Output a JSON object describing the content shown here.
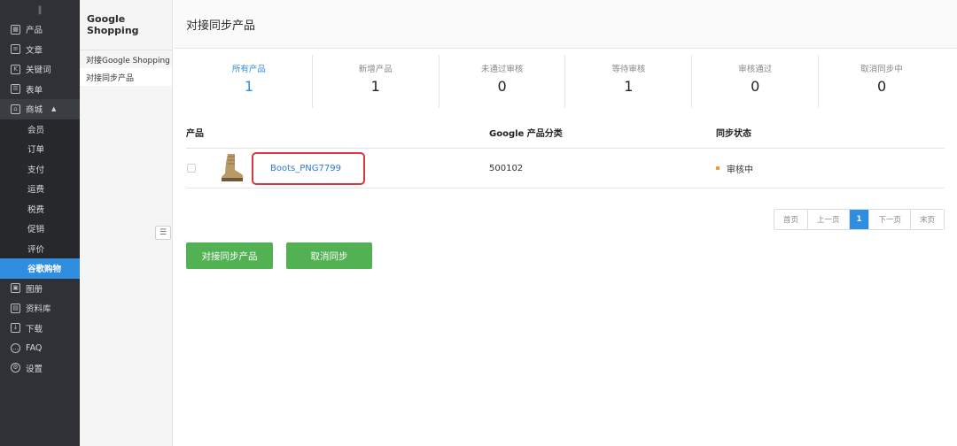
{
  "sidebar": {
    "top_icon": "‖",
    "items": [
      {
        "label": "产品",
        "icon": "grid-icon"
      },
      {
        "label": "文章",
        "icon": "document-icon"
      },
      {
        "label": "关键词",
        "icon": "keyword-icon"
      },
      {
        "label": "表单",
        "icon": "form-icon"
      },
      {
        "label": "商城",
        "icon": "shop-bag-icon"
      }
    ],
    "shop_sub": [
      {
        "label": "会员"
      },
      {
        "label": "订单"
      },
      {
        "label": "支付"
      },
      {
        "label": "运费"
      },
      {
        "label": "税费"
      },
      {
        "label": "促销"
      },
      {
        "label": "评价"
      },
      {
        "label": "谷歌购物"
      }
    ],
    "items_after": [
      {
        "label": "图册",
        "icon": "album-icon"
      },
      {
        "label": "资料库",
        "icon": "library-icon"
      },
      {
        "label": "下载",
        "icon": "download-icon"
      },
      {
        "label": "FAQ",
        "icon": "chat-icon"
      },
      {
        "label": "设置",
        "icon": "gear-icon"
      }
    ]
  },
  "panel2": {
    "title": "Google Shopping",
    "items": [
      {
        "label": "对接Google Shopping"
      },
      {
        "label": "对接同步产品"
      }
    ],
    "collapse_icon": "☰"
  },
  "main": {
    "header": "对接同步产品",
    "stats": [
      {
        "label": "所有产品",
        "value": "1"
      },
      {
        "label": "新增产品",
        "value": "1"
      },
      {
        "label": "未通过审核",
        "value": "0"
      },
      {
        "label": "等待审核",
        "value": "1"
      },
      {
        "label": "审核通过",
        "value": "0"
      },
      {
        "label": "取消同步中",
        "value": "0"
      }
    ],
    "table": {
      "headers": {
        "product": "产品",
        "category": "Google 产品分类",
        "status": "同步状态"
      },
      "rows": [
        {
          "product": "Boots_PNG7799",
          "category": "500102",
          "status": "审核中"
        }
      ]
    },
    "pager": {
      "first": "首页",
      "prev": "上一页",
      "current": "1",
      "next": "下一页",
      "last": "末页"
    },
    "buttons": {
      "sync": "对接同步产品",
      "cancel": "取消同步"
    }
  },
  "colors": {
    "sidebar_bg": "#2f3136",
    "accent": "#2f8ee0",
    "button_green": "#52b153",
    "highlight_red": "#d9373f",
    "status_dot": "#f0953a"
  }
}
